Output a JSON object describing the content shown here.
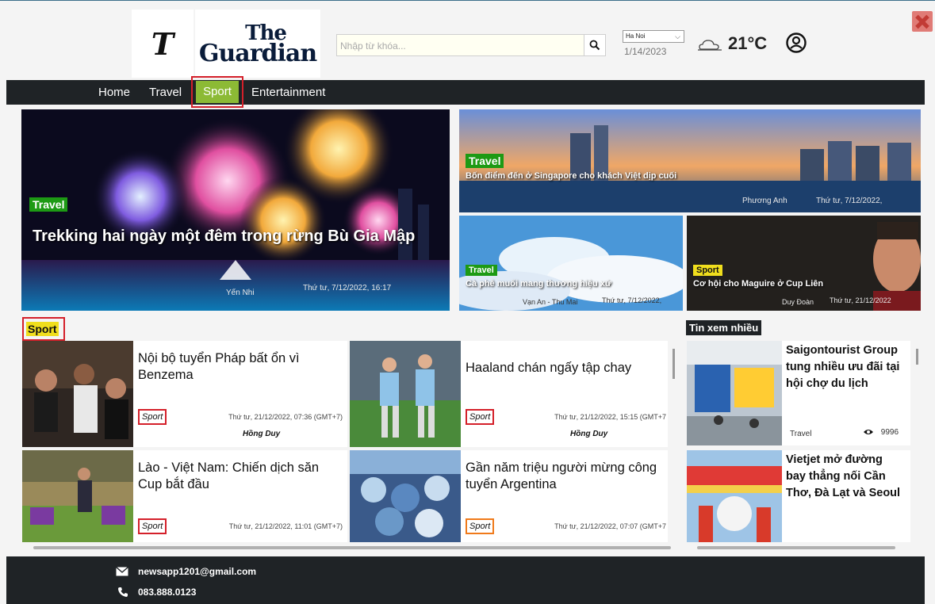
{
  "header": {
    "logo_t": "T",
    "logo_line1": "The",
    "logo_line2": "Guardian",
    "search_placeholder": "Nhập từ khóa...",
    "city": "Ha Noi",
    "date": "1/14/2023",
    "temperature": "21°C"
  },
  "nav": {
    "items": [
      "Home",
      "Travel",
      "Sport",
      "Entertainment"
    ]
  },
  "hero": {
    "main": {
      "tag": "Travel",
      "title": "Trekking hai ngày một đêm trong rừng Bù Gia Mập",
      "author": "Yến Nhi",
      "date": "Thứ tư, 7/12/2022, 16:17"
    },
    "top_right": {
      "tag": "Travel",
      "title": "Bốn điểm đến ở Singapore cho khách Việt dịp cuối",
      "author": "Phương Anh",
      "date": "Thứ tư, 7/12/2022,"
    },
    "bottom_left": {
      "tag": "Travel",
      "title": "Cà phê muối mang thương hiệu xứ",
      "author": "Vạn An - Thu Mai",
      "date": "Thứ tư, 7/12/2022,"
    },
    "bottom_right": {
      "tag": "Sport",
      "title": "Cơ hội cho Maguire ở Cup Liên",
      "author": "Duy Đoàn",
      "date": "Thứ tư, 21/12/2022"
    }
  },
  "sport_section": {
    "heading": "Sport",
    "articles": [
      {
        "title": "Nội bộ tuyển Pháp bất ổn vì Benzema",
        "badge": "Sport",
        "date": "Thứ tư, 21/12/2022, 07:36 (GMT+7)",
        "author": "Hồng Duy"
      },
      {
        "title": "Haaland chán ngấy tập chay",
        "badge": "Sport",
        "date": "Thứ tư, 21/12/2022, 15:15 (GMT+7",
        "author": "Hồng Duy"
      },
      {
        "title": "Lào - Việt Nam: Chiến dịch săn Cup bắt đầu",
        "badge": "Sport",
        "date": "Thứ tư, 21/12/2022, 11:01 (GMT+7)",
        "author": ""
      },
      {
        "title": "Gần năm triệu người mừng công tuyển Argentina",
        "badge": "Sport",
        "date": "Thứ tư, 21/12/2022, 07:07 (GMT+7",
        "author": ""
      }
    ]
  },
  "most_viewed": {
    "heading": "Tin xem nhiều",
    "items": [
      {
        "title": "Saigontourist Group tung nhiều ưu đãi tại hội chợ du lịch",
        "category": "Travel",
        "views": "9996"
      },
      {
        "title": "Vietjet mở đường bay thẳng nối Cần Thơ, Đà Lạt và Seoul",
        "category": "",
        "views": ""
      }
    ]
  },
  "footer": {
    "email": "newsapp1201@gmail.com",
    "phone": "083.888.0123"
  }
}
